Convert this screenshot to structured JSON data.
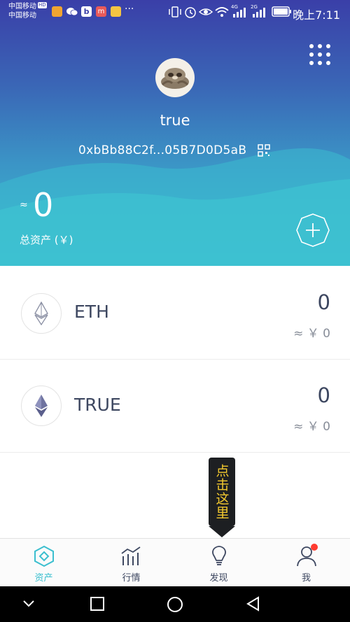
{
  "status_bar": {
    "carrier_1": "中国移动",
    "carrier_1_badge": "HD",
    "carrier_2": "中国移动",
    "network_1": "4G",
    "network_2": "2G",
    "time": "晚上7:11",
    "notification_more": "···",
    "notification_icon_b": "b",
    "notification_icon_m": "m"
  },
  "wallet": {
    "name": "true",
    "address": "0xbBb88C2f...05B7D0D5aB"
  },
  "summary": {
    "approx_symbol": "≈",
    "total_value": "0",
    "total_label": "总资产 (￥)"
  },
  "assets": [
    {
      "symbol": "ETH",
      "amount": "0",
      "fiat_value": "≈ ￥ 0"
    },
    {
      "symbol": "TRUE",
      "amount": "0",
      "fiat_value": "≈ ￥ 0"
    }
  ],
  "tooltip": {
    "text": "点击这里"
  },
  "tabbar": [
    {
      "label": "资产",
      "icon": "wallet-diamond-icon",
      "active": true
    },
    {
      "label": "行情",
      "icon": "market-chart-icon",
      "active": false
    },
    {
      "label": "发现",
      "icon": "lightbulb-icon",
      "active": false
    },
    {
      "label": "我",
      "icon": "person-icon",
      "active": false,
      "badge": true
    }
  ],
  "colors": {
    "header_top": "#3a3fa8",
    "header_bottom": "#3bbfd0",
    "accent": "#3bbfcf",
    "text_dark": "#3d4760",
    "tooltip_bg": "#1d1f22",
    "tooltip_text": "#f2c82e",
    "badge": "#ff3b30"
  }
}
